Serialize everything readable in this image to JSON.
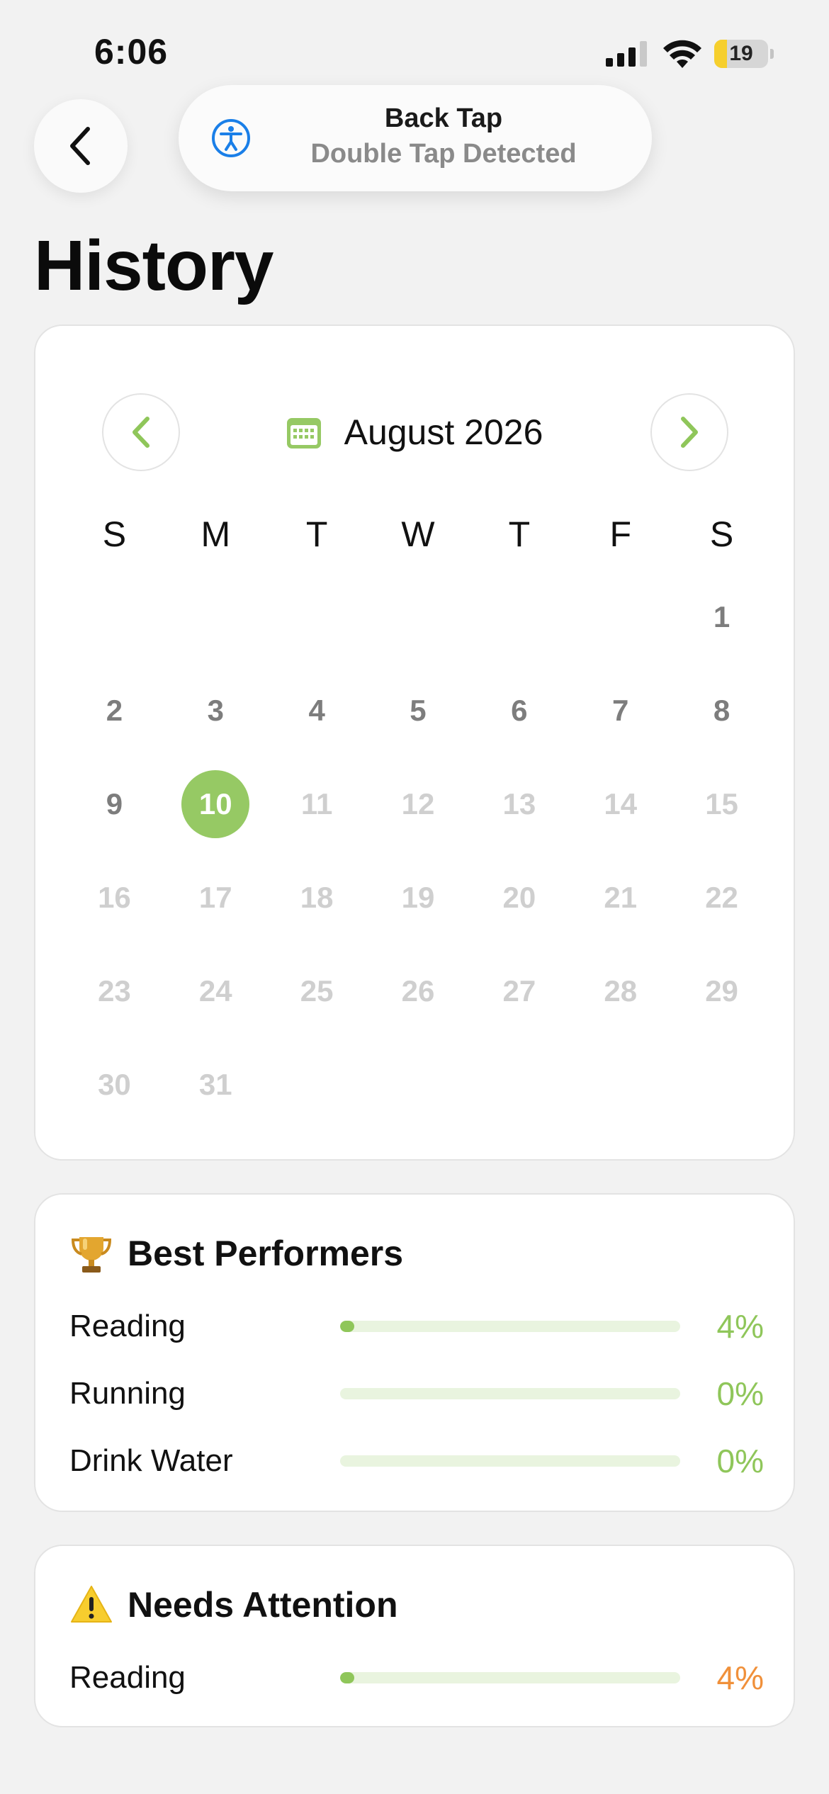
{
  "status_bar": {
    "time": "6:06",
    "battery_level": "19"
  },
  "banner": {
    "title": "Back Tap",
    "subtitle": "Double Tap Detected"
  },
  "page": {
    "title": "History"
  },
  "calendar": {
    "month_label": "August 2026",
    "weekdays": [
      "S",
      "M",
      "T",
      "W",
      "T",
      "F",
      "S"
    ],
    "leading_blanks": 6,
    "days_in_month": 31,
    "today": 10,
    "colors": {
      "accent": "#96c964",
      "past_day": "#7d7d7d",
      "future_day": "#cfcfcf"
    }
  },
  "best_performers": {
    "title": "Best Performers",
    "icon": "trophy-icon",
    "accent": "#8fc65a",
    "items": [
      {
        "label": "Reading",
        "percent": "4%",
        "progress": 0.04
      },
      {
        "label": "Running",
        "percent": "0%",
        "progress": 0
      },
      {
        "label": "Drink Water",
        "percent": "0%",
        "progress": 0
      }
    ]
  },
  "needs_attention": {
    "title": "Needs Attention",
    "icon": "warning-icon",
    "accent": "#f0903a",
    "items": [
      {
        "label": "Reading",
        "percent": "4%",
        "progress": 0.04
      }
    ]
  }
}
